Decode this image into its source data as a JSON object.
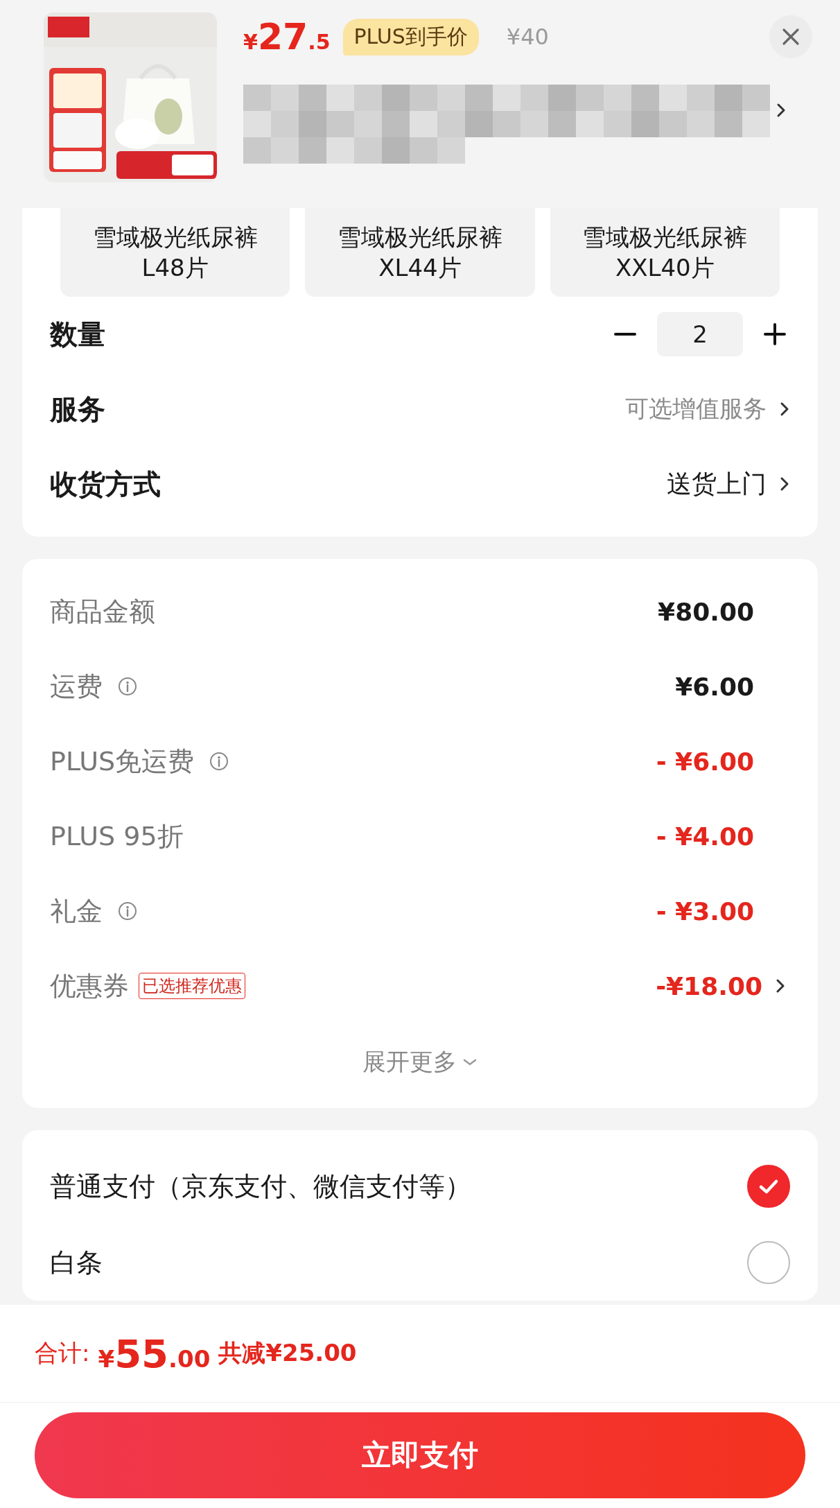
{
  "product": {
    "price": {
      "currency": "¥",
      "integer": "27",
      "decimal": ".5"
    },
    "price_badge": "PLUS到手价",
    "original_price": "¥40"
  },
  "variants": [
    {
      "label": "雪域极光纸尿裤\nL48片",
      "selected": false
    },
    {
      "label": "雪域极光纸尿裤\nXL44片",
      "selected": false
    },
    {
      "label": "雪域极光纸尿裤\nXXL40片",
      "selected": false
    }
  ],
  "quantity": {
    "label": "数量",
    "value": "2"
  },
  "options": [
    {
      "label": "服务",
      "value": "可选增值服务",
      "kind": "hint"
    },
    {
      "label": "收货方式",
      "value": "送货上门",
      "kind": "value"
    }
  ],
  "costs": [
    {
      "label": "商品金额",
      "amount": "¥80.00",
      "info": false,
      "discount": false,
      "chevron": false
    },
    {
      "label": "运费",
      "amount": "¥6.00",
      "info": true,
      "discount": false,
      "chevron": false
    },
    {
      "label": "PLUS免运费",
      "amount": "- ¥6.00",
      "info": true,
      "discount": true,
      "chevron": false
    },
    {
      "label": "PLUS 95折",
      "amount": "- ¥4.00",
      "info": false,
      "discount": true,
      "chevron": false
    },
    {
      "label": "礼金",
      "amount": "- ¥3.00",
      "info": true,
      "discount": true,
      "chevron": false
    },
    {
      "label": "优惠券",
      "tag": "已选推荐优惠",
      "amount": "-¥18.00",
      "info": false,
      "discount": true,
      "chevron": true
    }
  ],
  "expand": "展开更多",
  "payments": [
    {
      "label": "普通支付（京东支付、微信支付等）",
      "selected": true
    },
    {
      "label": "白条",
      "selected": false
    }
  ],
  "footer": {
    "total_label": "合计:",
    "total": {
      "currency": "¥",
      "integer": "55",
      "decimal": ".00"
    },
    "saving": "共减¥25.00",
    "pay_button": "立即支付"
  }
}
